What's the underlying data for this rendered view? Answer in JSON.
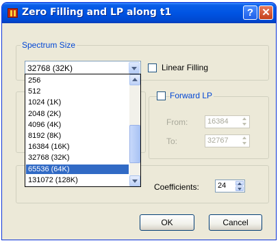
{
  "window": {
    "title": "Zero Filling and LP along t1",
    "help_glyph": "?",
    "close_glyph": "✕"
  },
  "spectrum_size": {
    "group_title": "Spectrum Size",
    "selected_value": "32768 (32K)",
    "linear_filling_label": "Linear Filling",
    "linear_filling_checked": false,
    "options": [
      "256",
      "512",
      "1024 (1K)",
      "2048 (2K)",
      "4096 (4K)",
      "8192 (8K)",
      "16384 (16K)",
      "32768 (32K)",
      "65536 (64K)",
      "131072 (128K)"
    ],
    "highlighted_option": "65536 (64K)"
  },
  "forward_lp": {
    "label": "Forward LP",
    "checked": false,
    "from_label": "From:",
    "from_value": "16384",
    "to_label": "To:",
    "to_value": "32767"
  },
  "coefficients": {
    "label": "Coefficients:",
    "value": "24"
  },
  "buttons": {
    "ok": "OK",
    "cancel": "Cancel"
  },
  "colors": {
    "titlebar": "#0054e3",
    "group_title": "#0046d5",
    "selection": "#316ac5",
    "dialog_bg": "#ece9d8"
  }
}
